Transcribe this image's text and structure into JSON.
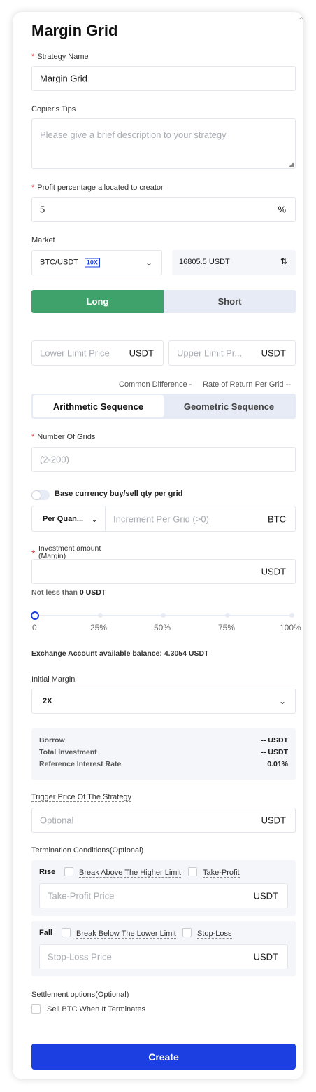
{
  "title": "Margin Grid",
  "strategy_name": {
    "label": "Strategy Name",
    "value": "Margin Grid"
  },
  "tips": {
    "label": "Copier's Tips",
    "placeholder": "Please give a brief description to your strategy"
  },
  "profit": {
    "label": "Profit percentage allocated to creator",
    "value": "5",
    "unit": "%"
  },
  "market": {
    "label": "Market",
    "pair": "BTC/USDT",
    "leverage": "10X",
    "price": "16805.5 USDT"
  },
  "direction": {
    "long": "Long",
    "short": "Short"
  },
  "limits": {
    "lower_ph": "Lower Limit Price",
    "upper_ph": "Upper Limit Pr...",
    "unit": "USDT"
  },
  "diff": {
    "common": "Common Difference -",
    "rate": "Rate of Return Per Grid --"
  },
  "sequence": {
    "arith": "Arithmetic Sequence",
    "geo": "Geometric Sequence"
  },
  "grids": {
    "label": "Number Of Grids",
    "placeholder": "(2-200)"
  },
  "base_toggle": {
    "label": "Base currency buy/sell qty per grid"
  },
  "per_qty": {
    "select": "Per Quan...",
    "placeholder": "Increment Per Grid (>0)",
    "unit": "BTC"
  },
  "investment": {
    "label_line1": "Investment amount",
    "label_line2": "(Margin)",
    "unit": "USDT",
    "min_prefix": "Not less than ",
    "min_value": "0 USDT"
  },
  "slider": {
    "level": 0,
    "ticks": [
      "0",
      "25%",
      "50%",
      "75%",
      "100%"
    ]
  },
  "balance": "Exchange Account available balance: 4.3054 USDT",
  "initial_margin": {
    "label": "Initial Margin",
    "value": "2X"
  },
  "summary": [
    {
      "k": "Borrow",
      "v": "-- USDT"
    },
    {
      "k": "Total Investment",
      "v": "-- USDT"
    },
    {
      "k": "Reference Interest Rate",
      "v": "0.01%"
    }
  ],
  "trigger": {
    "label": "Trigger Price Of The Strategy",
    "placeholder": "Optional",
    "unit": "USDT"
  },
  "termination": {
    "label": "Termination Conditions(Optional)",
    "rise": {
      "title": "Rise",
      "opt1": "Break Above The Higher Limit",
      "opt2": "Take-Profit",
      "placeholder": "Take-Profit Price",
      "unit": "USDT"
    },
    "fall": {
      "title": "Fall",
      "opt1": "Break Below The Lower Limit",
      "opt2": "Stop-Loss",
      "placeholder": "Stop-Loss Price",
      "unit": "USDT"
    }
  },
  "settlement": {
    "label": "Settlement options(Optional)",
    "opt": "Sell BTC When It Terminates"
  },
  "create": "Create",
  "colors": {
    "accent": "#1b3fe0",
    "long": "#3ea26a",
    "short_bg": "#e6ebf5"
  },
  "icons": [
    "close-icon",
    "chevron-down-icon",
    "swap-icon",
    "toggle-switch"
  ]
}
